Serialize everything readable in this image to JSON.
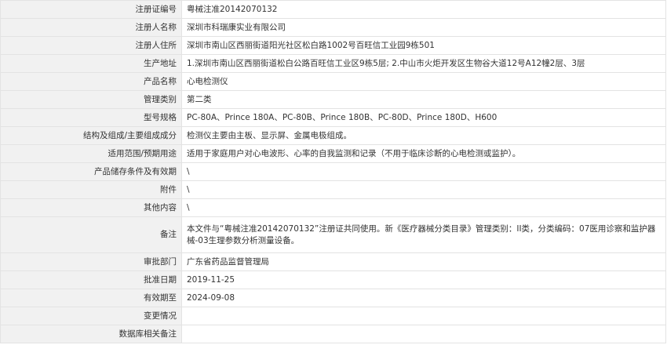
{
  "rows": [
    {
      "label": "注册证编号",
      "value": "粤械注准20142070132"
    },
    {
      "label": "注册人名称",
      "value": "深圳市科瑞康实业有限公司"
    },
    {
      "label": "注册人住所",
      "value": "深圳市南山区西丽街道阳光社区松白路1002号百旺信工业园9栋501"
    },
    {
      "label": "生产地址",
      "value": "1.深圳市南山区西丽街道松白公路百旺信工业区9栋5层; 2.中山市火炬开发区生物谷大道12号A12幢2层、3层"
    },
    {
      "label": "产品名称",
      "value": "心电检测仪"
    },
    {
      "label": "管理类别",
      "value": "第二类"
    },
    {
      "label": "型号规格",
      "value": "PC-80A、Prince 180A、PC-80B、Prince 180B、PC-80D、Prince 180D、H600"
    },
    {
      "label": "结构及组成/主要组成成分",
      "value": "检测仪主要由主板、显示屏、金属电极组成。"
    },
    {
      "label": "适用范围/预期用途",
      "value": "适用于家庭用户对心电波形、心率的自我监测和记录（不用于临床诊断的心电检测或监护）。"
    },
    {
      "label": "产品储存条件及有效期",
      "value": "\\"
    },
    {
      "label": "附件",
      "value": "\\"
    },
    {
      "label": "其他内容",
      "value": "\\"
    },
    {
      "label": "备注",
      "value": "本文件与“粤械注准20142070132”注册证共同使用。新《医疗器械分类目录》管理类别：II类，分类编码：07医用诊察和监护器械-03生理参数分析测量设备。"
    },
    {
      "label": "审批部门",
      "value": "广东省药品监督管理局"
    },
    {
      "label": "批准日期",
      "value": "2019-11-25"
    },
    {
      "label": "有效期至",
      "value": "2024-09-08"
    },
    {
      "label": "变更情况",
      "value": ""
    },
    {
      "label": "数据库相关备注",
      "value": ""
    }
  ]
}
